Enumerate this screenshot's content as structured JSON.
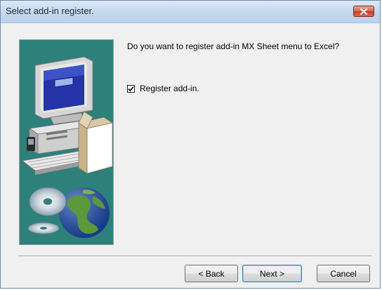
{
  "window": {
    "title": "Select add-in register."
  },
  "content": {
    "question": "Do you want to register add-in MX Sheet menu to Excel?",
    "checkbox": {
      "label": "Register add-in.",
      "checked": true
    }
  },
  "buttons": {
    "back_label": "< Back",
    "next_label": "Next >",
    "cancel_label": "Cancel"
  },
  "colors": {
    "art_background": "#2e807b",
    "close_button": "#c9462c"
  },
  "icons": {
    "close": "close-icon",
    "checkbox_mark": "checkmark-icon",
    "art": "computer-with-cds-and-globe"
  }
}
